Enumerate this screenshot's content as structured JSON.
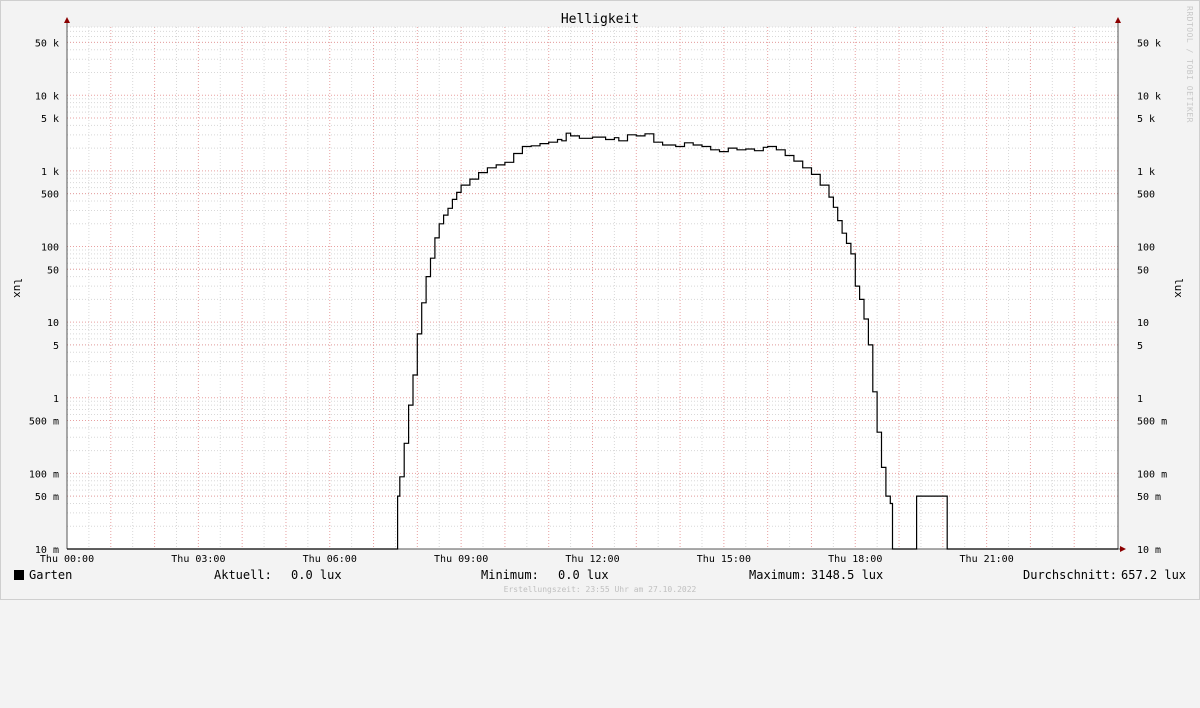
{
  "chart_data": {
    "type": "line",
    "title": "Helligkeit",
    "ylabel": "lux",
    "yscale": "log",
    "ylim": [
      0.01,
      80000
    ],
    "xlim": [
      0,
      24
    ],
    "x_ticks": [
      {
        "x": 0,
        "label": "Thu 00:00"
      },
      {
        "x": 3,
        "label": "Thu 03:00"
      },
      {
        "x": 6,
        "label": "Thu 06:00"
      },
      {
        "x": 9,
        "label": "Thu 09:00"
      },
      {
        "x": 12,
        "label": "Thu 12:00"
      },
      {
        "x": 15,
        "label": "Thu 15:00"
      },
      {
        "x": 18,
        "label": "Thu 18:00"
      },
      {
        "x": 21,
        "label": "Thu 21:00"
      }
    ],
    "y_ticks": [
      {
        "y": 50000,
        "label": "50 k"
      },
      {
        "y": 10000,
        "label": "10 k"
      },
      {
        "y": 5000,
        "label": "5 k"
      },
      {
        "y": 1000,
        "label": "1 k"
      },
      {
        "y": 500,
        "label": "500"
      },
      {
        "y": 100,
        "label": "100"
      },
      {
        "y": 50,
        "label": "50"
      },
      {
        "y": 10,
        "label": "10"
      },
      {
        "y": 5,
        "label": "5"
      },
      {
        "y": 1,
        "label": "1"
      },
      {
        "y": 0.5,
        "label": "500 m"
      },
      {
        "y": 0.1,
        "label": "100 m"
      },
      {
        "y": 0.05,
        "label": "50 m"
      },
      {
        "y": 0.01,
        "label": "10 m"
      }
    ],
    "grid": true,
    "series": [
      {
        "name": "Garten",
        "color": "#000000",
        "points": [
          [
            0,
            0.01
          ],
          [
            7.5,
            0.01
          ],
          [
            7.55,
            0.05
          ],
          [
            7.6,
            0.09
          ],
          [
            7.7,
            0.25
          ],
          [
            7.8,
            0.8
          ],
          [
            7.9,
            2
          ],
          [
            8.0,
            7
          ],
          [
            8.1,
            18
          ],
          [
            8.2,
            40
          ],
          [
            8.3,
            70
          ],
          [
            8.4,
            130
          ],
          [
            8.5,
            200
          ],
          [
            8.6,
            260
          ],
          [
            8.7,
            320
          ],
          [
            8.8,
            420
          ],
          [
            8.9,
            520
          ],
          [
            9.0,
            650
          ],
          [
            9.2,
            780
          ],
          [
            9.4,
            950
          ],
          [
            9.6,
            1100
          ],
          [
            9.8,
            1200
          ],
          [
            10.0,
            1300
          ],
          [
            10.2,
            1700
          ],
          [
            10.4,
            2100
          ],
          [
            10.6,
            2150
          ],
          [
            10.8,
            2300
          ],
          [
            11.0,
            2400
          ],
          [
            11.2,
            2600
          ],
          [
            11.3,
            2500
          ],
          [
            11.4,
            3148.5
          ],
          [
            11.5,
            2900
          ],
          [
            11.7,
            2700
          ],
          [
            12.0,
            2800
          ],
          [
            12.3,
            2600
          ],
          [
            12.5,
            2750
          ],
          [
            12.6,
            2500
          ],
          [
            12.8,
            3000
          ],
          [
            13.0,
            2900
          ],
          [
            13.2,
            3100
          ],
          [
            13.4,
            2400
          ],
          [
            13.6,
            2200
          ],
          [
            13.9,
            2100
          ],
          [
            14.1,
            2350
          ],
          [
            14.3,
            2200
          ],
          [
            14.5,
            2100
          ],
          [
            14.7,
            1900
          ],
          [
            14.9,
            1800
          ],
          [
            15.1,
            2000
          ],
          [
            15.3,
            1900
          ],
          [
            15.5,
            1950
          ],
          [
            15.7,
            1850
          ],
          [
            15.9,
            2050
          ],
          [
            16.0,
            2100
          ],
          [
            16.2,
            1900
          ],
          [
            16.4,
            1600
          ],
          [
            16.6,
            1350
          ],
          [
            16.8,
            1100
          ],
          [
            17.0,
            900
          ],
          [
            17.2,
            650
          ],
          [
            17.4,
            450
          ],
          [
            17.5,
            330
          ],
          [
            17.6,
            220
          ],
          [
            17.7,
            150
          ],
          [
            17.8,
            110
          ],
          [
            17.9,
            80
          ],
          [
            18.0,
            30
          ],
          [
            18.1,
            20
          ],
          [
            18.2,
            11
          ],
          [
            18.3,
            5
          ],
          [
            18.4,
            1.2
          ],
          [
            18.5,
            0.35
          ],
          [
            18.6,
            0.12
          ],
          [
            18.7,
            0.05
          ],
          [
            18.8,
            0.04
          ],
          [
            18.85,
            0.01
          ],
          [
            19.35,
            0.01
          ],
          [
            19.4,
            0.05
          ],
          [
            20.05,
            0.05
          ],
          [
            20.1,
            0.01
          ],
          [
            24,
            0.01
          ]
        ]
      }
    ]
  },
  "watermark": "RRDTOOL / TOBI OETIKER",
  "legend": {
    "series_name": "Garten",
    "current_label": "Aktuell:",
    "current_value": "0.0 lux",
    "min_label": "Minimum:",
    "min_value": "0.0 lux",
    "max_label": "Maximum:",
    "max_value": "3148.5 lux",
    "avg_label": "Durchschnitt:",
    "avg_value": "657.2 lux"
  },
  "created_text": "Erstellungszeit: 23:55 Uhr am 27.10.2022"
}
